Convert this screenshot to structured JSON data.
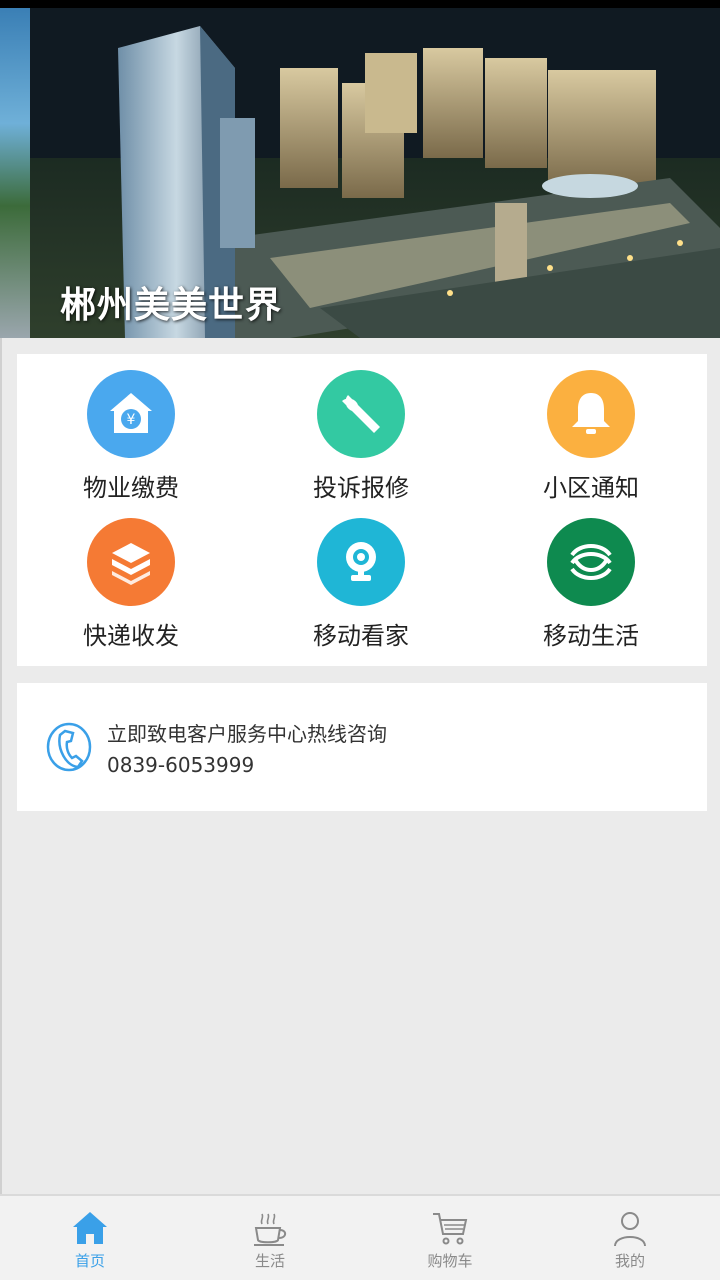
{
  "banner": {
    "title": "郴州美美世界"
  },
  "services": [
    {
      "label": "物业缴费",
      "icon": "property-fee-icon",
      "color": "#4aa8ee"
    },
    {
      "label": "投诉报修",
      "icon": "wrench-icon",
      "color": "#33c9a2"
    },
    {
      "label": "小区通知",
      "icon": "bell-icon",
      "color": "#fbb040"
    },
    {
      "label": "快递收发",
      "icon": "package-icon",
      "color": "#f57a34"
    },
    {
      "label": "移动看家",
      "icon": "camera-icon",
      "color": "#1fb6d6"
    },
    {
      "label": "移动生活",
      "icon": "china-mobile-icon",
      "color": "#0e8a4f"
    }
  ],
  "hotline": {
    "text": "立即致电客户服务中心热线咨询",
    "number": "0839-6053999",
    "icon": "phone-icon"
  },
  "tabs": [
    {
      "label": "首页",
      "icon": "home-icon",
      "active": true
    },
    {
      "label": "生活",
      "icon": "coffee-cup-icon",
      "active": false
    },
    {
      "label": "购物车",
      "icon": "cart-icon",
      "active": false
    },
    {
      "label": "我的",
      "icon": "user-icon",
      "active": false
    }
  ],
  "colors": {
    "accent": "#3aa0e8",
    "background": "#ebebeb"
  }
}
